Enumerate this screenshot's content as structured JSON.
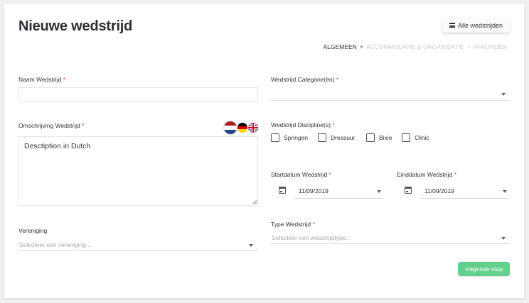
{
  "page": {
    "title": "Nieuwe wedstrijd"
  },
  "header": {
    "all_button_label": "Alle wedstrijden",
    "all_button_icon": "list-icon"
  },
  "breadcrumb": {
    "steps": [
      "ALGEMEEN",
      "ACCOMMODATIE & ORGANISATIE",
      "AFRONDEN"
    ],
    "separator": ">",
    "active_index": 0
  },
  "form": {
    "name": {
      "label": "Naam Wedstrijd",
      "required_mark": "*",
      "value": ""
    },
    "category": {
      "label": "Wedstrijd Categorie(ën)",
      "required_mark": "*",
      "value": ""
    },
    "description": {
      "label": "Omschrijving Wedstrijd",
      "required_mark": "*",
      "value": "Desctiption in Dutch",
      "languages": [
        "nl-flag-icon",
        "de-flag-icon",
        "gb-flag-icon"
      ]
    },
    "disciplines": {
      "label": "Wedstrijd Discipline(s)",
      "required_mark": "*",
      "options": [
        "Springen",
        "Dressuur",
        "Bixie",
        "Clinic"
      ]
    },
    "start_date": {
      "label": "Startdatum Wedstrijd",
      "required_mark": "*",
      "value": "11/09/2019",
      "icon": "calendar-icon"
    },
    "end_date": {
      "label": "Einddatum Wedstrijd",
      "required_mark": "*",
      "value": "11/09/2019",
      "icon": "calendar-icon"
    },
    "association": {
      "label": "Vereniging",
      "placeholder": "Selecteer een vereniging..."
    },
    "type": {
      "label": "Type Wedstrijd",
      "required_mark": "*",
      "placeholder": "Selecteer een wedstrijdtype..."
    }
  },
  "footer": {
    "next_label": "volgende stap"
  },
  "colors": {
    "required": "#e0454f",
    "accent": "#62cf8d",
    "muted_step": "#c6c9cc"
  }
}
